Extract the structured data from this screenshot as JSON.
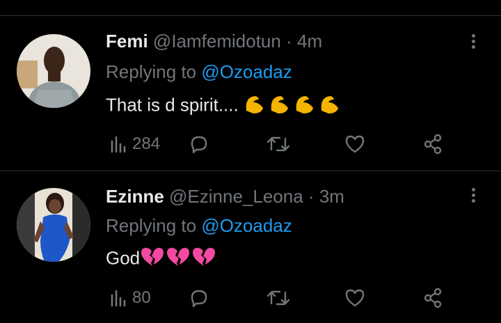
{
  "tweets": [
    {
      "name": "Femi",
      "handle": "@Iamfemidotun",
      "sep": "·",
      "time": "4m",
      "reply_prefix": "Replying to ",
      "reply_to": "@Ozoadaz",
      "text": "That is d spirit....",
      "emojis": [
        "flexed-biceps",
        "flexed-biceps",
        "flexed-biceps",
        "flexed-biceps"
      ],
      "views": "284",
      "icons": [
        "views-icon",
        "reply-icon",
        "retweet-icon",
        "like-icon",
        "share-icon"
      ],
      "colors": {
        "emoji": "#f5b400"
      }
    },
    {
      "name": "Ezinne",
      "handle": "@Ezinne_Leona",
      "sep": "·",
      "time": "3m",
      "reply_prefix": "Replying to ",
      "reply_to": "@Ozoadaz",
      "text": "God",
      "emojis": [
        "broken-heart",
        "broken-heart",
        "broken-heart"
      ],
      "views": "80",
      "icons": [
        "views-icon",
        "reply-icon",
        "retweet-icon",
        "like-icon",
        "share-icon"
      ],
      "colors": {
        "emoji": "#f14aa0"
      }
    }
  ],
  "colors": {
    "background": "#000000",
    "text": "#e7e9ea",
    "muted": "#71767b",
    "link": "#1d9bf0",
    "divider": "#2f3336"
  }
}
